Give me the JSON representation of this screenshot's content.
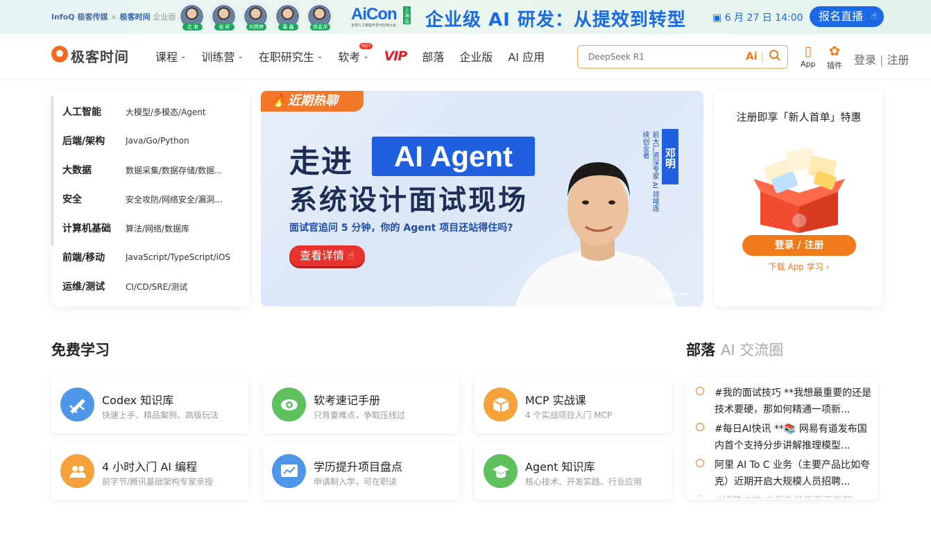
{
  "banner": {
    "brand_infoq": "InfoQ 极客传媒",
    "brand_sep": "×",
    "brand_geek": "极客时间",
    "brand_enterprise": "企业版",
    "speakers": [
      "沈 浪",
      "张 昕",
      "刘秀婷",
      "董 鑫",
      "徐孟洋"
    ],
    "aicon_logo": "AiCon",
    "aicon_sub": "全球人工智能开发与应用大会",
    "aicon_loc": "上海站",
    "slogan": "企业级 AI 研发：从提效到转型",
    "date": "6 月 27 日 14:00",
    "cta": "报名直播"
  },
  "nav": {
    "logo": "极客时间",
    "menu": [
      {
        "label": "课程",
        "caret": true
      },
      {
        "label": "训练营",
        "caret": true
      },
      {
        "label": "在职研究生",
        "caret": true
      },
      {
        "label": "软考",
        "caret": true,
        "badge": "HOT"
      },
      {
        "label": "VIP",
        "caret": false
      },
      {
        "label": "部落",
        "caret": false
      },
      {
        "label": "企业版",
        "caret": false
      },
      {
        "label": "AI 应用",
        "caret": false
      }
    ],
    "search_placeholder": "DeepSeek R1",
    "search_ai": "Ai",
    "app_label": "App",
    "plugin_label": "插件",
    "login": "登录",
    "divider": "|",
    "register": "注册"
  },
  "categories": [
    {
      "title": "人工智能",
      "sub": "大模型/多模态/Agent"
    },
    {
      "title": "后端/架构",
      "sub": "Java/Go/Python"
    },
    {
      "title": "大数据",
      "sub": "数据采集/数据存储/数据..."
    },
    {
      "title": "安全",
      "sub": "安全攻防/网络安全/漏洞..."
    },
    {
      "title": "计算机基础",
      "sub": "算法/网络/数据库"
    },
    {
      "title": "前端/移动",
      "sub": "JavaScript/TypeScript/iOS"
    },
    {
      "title": "运维/测试",
      "sub": "CI/CD/SRE/测试"
    }
  ],
  "hero": {
    "tag": "近期热聊",
    "title_pre": "走进",
    "title_chip": "AI Agent",
    "title_line2": "系统设计面试现场",
    "subtitle": "面试官追问 5 分钟，你的 Agent 项目还站得住吗?",
    "cta": "查看详情",
    "speaker_name": "邓明",
    "speaker_role": "前大厂资深专家 AI 领域连续创业者"
  },
  "promo": {
    "title": "注册即享「新人首单」特惠",
    "login_button": "登录 / 注册",
    "download": "下载 App 学习 ›"
  },
  "free_learning": {
    "title": "免费学习",
    "cards": [
      {
        "title": "Codex 知识库",
        "sub": "快速上手、精品案例、高级玩法",
        "color": "#4e97e8",
        "icon": "sword-icon"
      },
      {
        "title": "软考速记手册",
        "sub": "只背重难点，争取压线过",
        "color": "#5fc15e",
        "icon": "eye-icon"
      },
      {
        "title": "MCP 实战课",
        "sub": "4 个实战项目入门 MCP",
        "color": "#f5a13c",
        "icon": "box-icon"
      },
      {
        "title": "4 小时入门 AI 编程",
        "sub": "前字节/腾讯基础架构专家亲授",
        "color": "#f5a13c",
        "icon": "users-icon"
      },
      {
        "title": "学历提升项目盘点",
        "sub": "申请制入学，可在职读",
        "color": "#4e97e8",
        "icon": "chart-icon"
      },
      {
        "title": "Agent 知识库",
        "sub": "核心技术、开发实践、行业应用",
        "color": "#5fc15e",
        "icon": "graduation-cap-icon"
      }
    ]
  },
  "tribe": {
    "title": "部落",
    "subtitle": "AI 交流圈",
    "posts": [
      "#我的面试技巧 **我想最重要的还是技术要硬，那如何精通一项新...",
      "#每日AI快讯 **📚 网易有道发布国内首个支持分步讲解推理模型...",
      "阿里 AI To C 业务（主要产品比如夸克）近期开启大规模人员招聘...",
      "#招聘内推 内巨先是离直下年薪|"
    ]
  }
}
